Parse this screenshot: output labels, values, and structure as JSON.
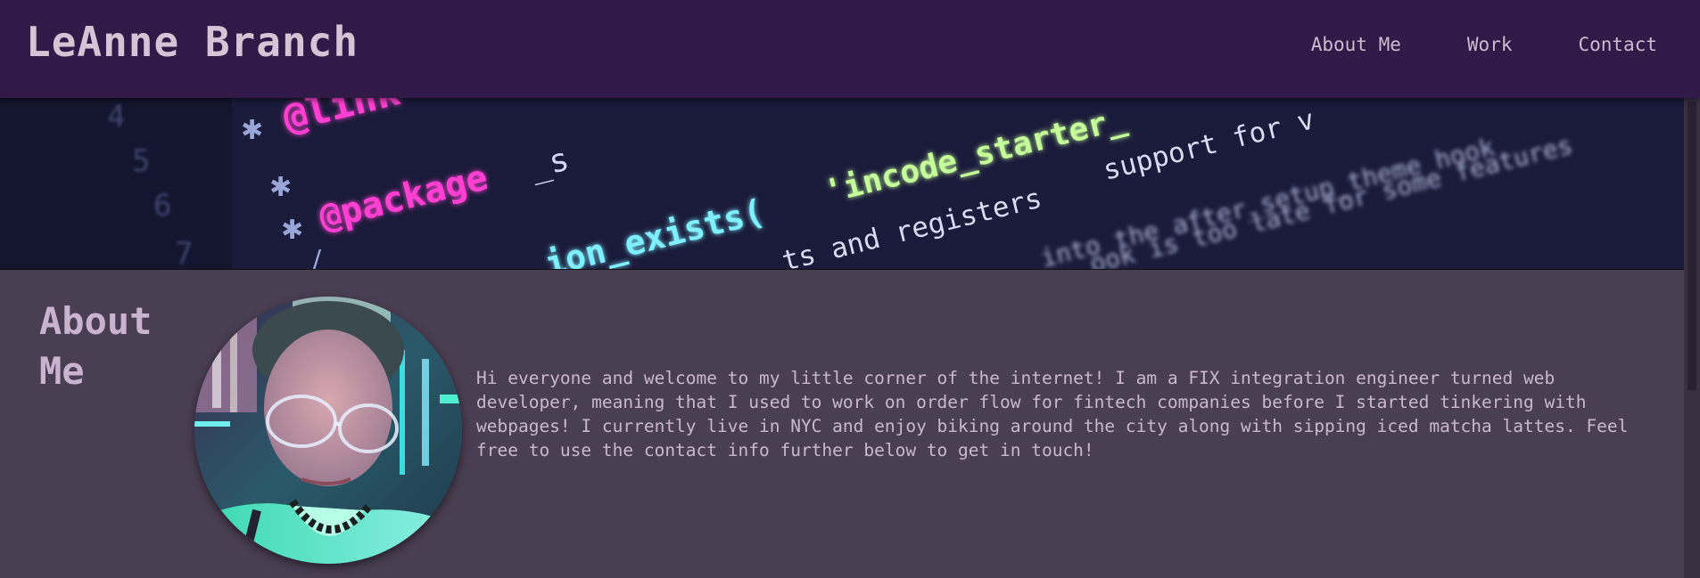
{
  "header": {
    "title": "LeAnne Branch",
    "nav": [
      {
        "label": "About Me"
      },
      {
        "label": "Work"
      },
      {
        "label": "Contact"
      }
    ]
  },
  "hero": {
    "code_fragments": [
      "@link",
      "@package",
      "_s",
      "ion_exists(",
      "'incode_starter_",
      "support for v",
      "ts and registers",
      "into the after_setup_theme hook",
      "ook is too late for some features",
      "4",
      "5",
      "6",
      "7"
    ]
  },
  "about": {
    "heading": "About Me",
    "body": "Hi everyone and welcome to my little corner of the internet! I am a FIX integration engineer turned web developer, meaning that I used to work on order flow for fintech companies before I started tinkering with webpages! I currently live in NYC and enjoy biking around the city along with sipping iced matcha lattes. Feel free to use the contact info further below to get in touch!"
  },
  "colors": {
    "header_bg": "#311a47",
    "page_bg": "#4a3e52",
    "title_text": "#d4c4d6",
    "nav_text": "#cbbccf",
    "heading_text": "#c9b3cf",
    "body_text": "#c9b8cd",
    "code_magenta": "#ff3fd2",
    "code_green": "#c6ff9a",
    "code_cyan": "#7ff0ff"
  }
}
